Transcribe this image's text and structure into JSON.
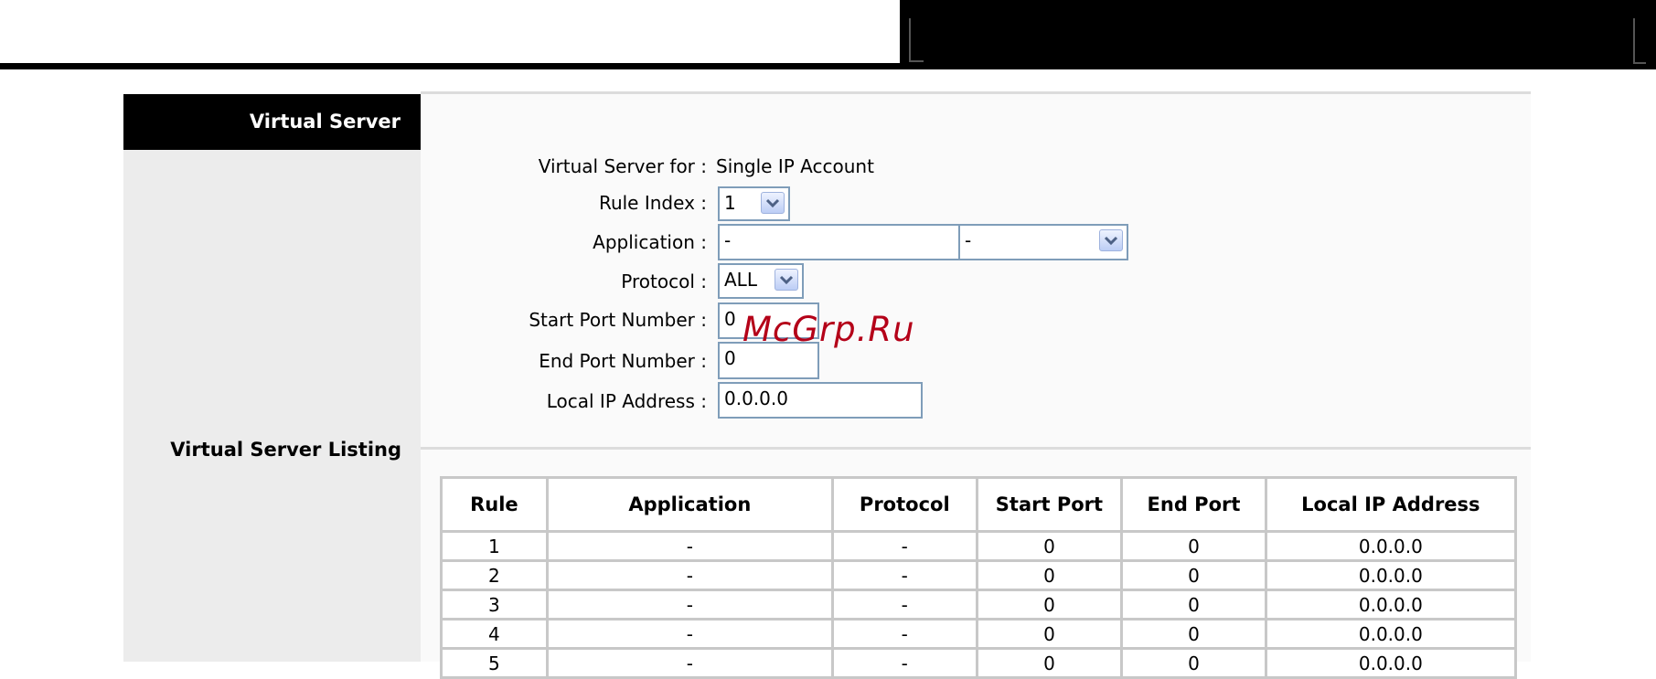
{
  "section": {
    "title": "Virtual Server",
    "listing_title": "Virtual Server Listing"
  },
  "form": {
    "for_label": "Virtual Server for :",
    "for_value": "Single IP Account",
    "rule_index_label": "Rule Index :",
    "rule_index_value": "1",
    "application_label": "Application :",
    "application_value": "-",
    "application_select_value": "-",
    "protocol_label": "Protocol :",
    "protocol_value": "ALL",
    "start_port_label": "Start Port Number :",
    "start_port_value": "0",
    "end_port_label": "End Port Number :",
    "end_port_value": "0",
    "local_ip_label": "Local IP Address :",
    "local_ip_value": "0.0.0.0"
  },
  "watermark": "McGrp.Ru",
  "table": {
    "columns": [
      "Rule",
      "Application",
      "Protocol",
      "Start Port",
      "End Port",
      "Local IP Address"
    ],
    "rows": [
      [
        "1",
        "-",
        "-",
        "0",
        "0",
        "0.0.0.0"
      ],
      [
        "2",
        "-",
        "-",
        "0",
        "0",
        "0.0.0.0"
      ],
      [
        "3",
        "-",
        "-",
        "0",
        "0",
        "0.0.0.0"
      ],
      [
        "4",
        "-",
        "-",
        "0",
        "0",
        "0.0.0.0"
      ],
      [
        "5",
        "-",
        "-",
        "0",
        "0",
        "0.0.0.0"
      ]
    ]
  },
  "colors": {
    "header_bg": "#000000",
    "sidebar_bg": "#ececec",
    "input_border": "#7f9db9",
    "watermark": "#b40018"
  }
}
